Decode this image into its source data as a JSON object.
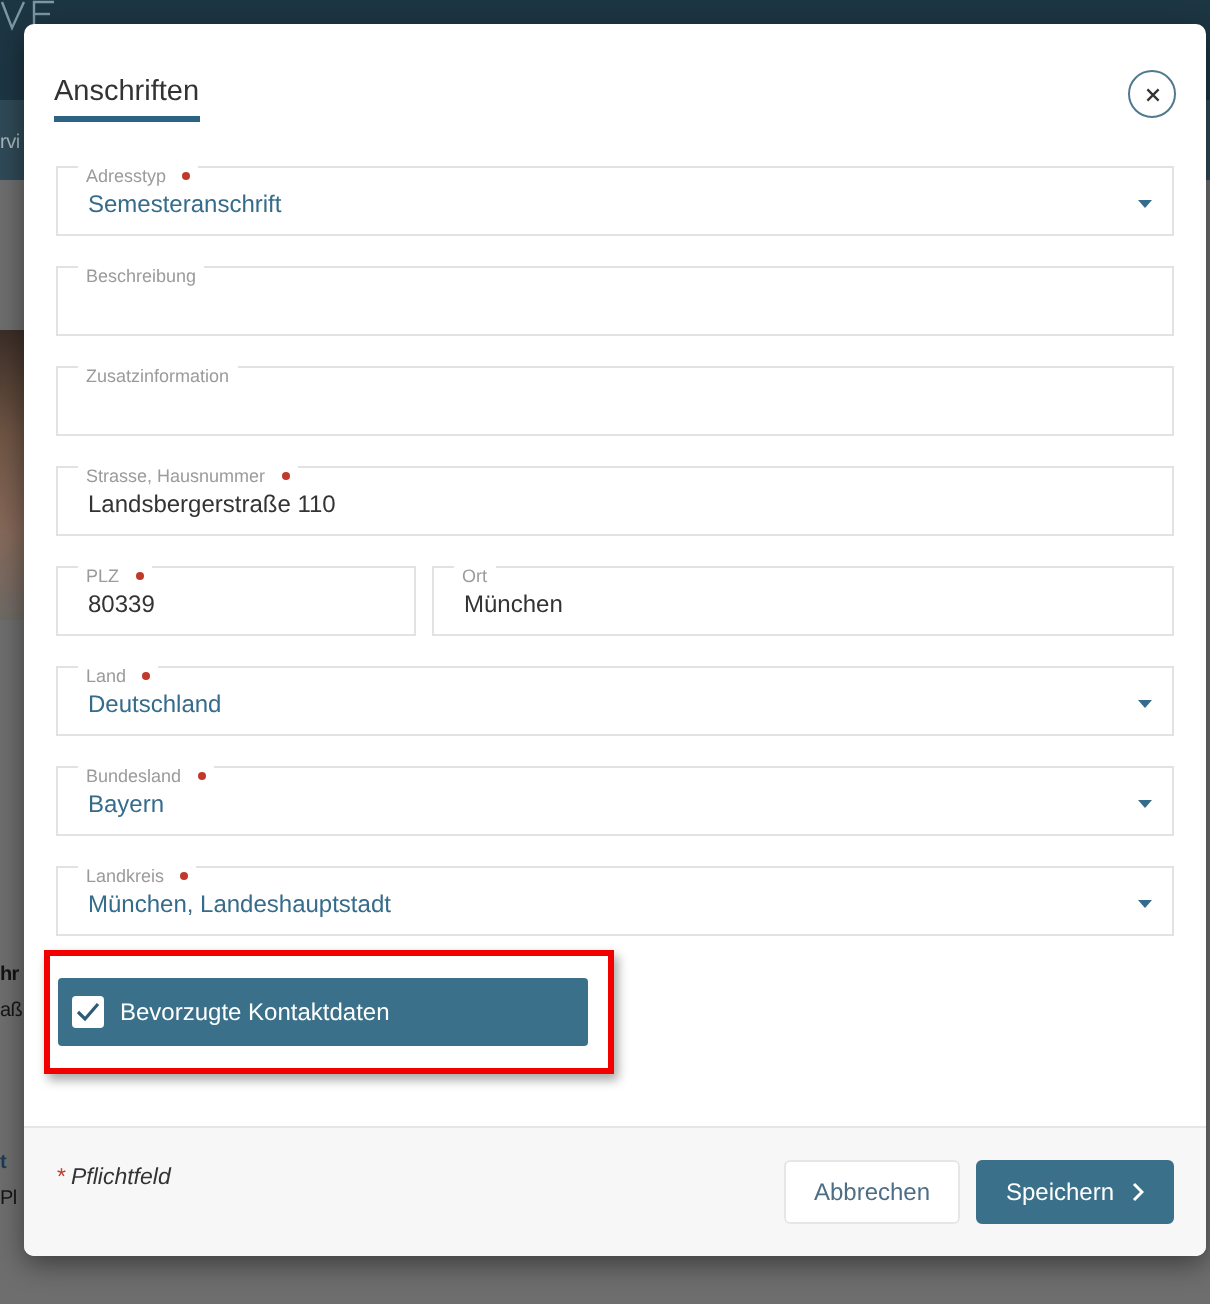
{
  "page_behind": {
    "nav_item": "rvi",
    "text_groups": [
      {
        "kind": "plain",
        "title": "hr",
        "detail": "aß"
      },
      {
        "kind": "link",
        "title": "t",
        "detail": "Pl"
      }
    ]
  },
  "dialog": {
    "title": "Anschriften",
    "fields": [
      {
        "kind": "select",
        "label": "Adresstyp",
        "required": true,
        "value": "Semesteranschrift"
      },
      {
        "kind": "input",
        "label": "Beschreibung",
        "required": false
      },
      {
        "kind": "input",
        "label": "Zusatzinformation",
        "required": false
      },
      {
        "kind": "input",
        "label": "Strasse, Hausnummer",
        "required": true,
        "value": "Landsbergerstraße 110"
      },
      {
        "kind": "pair",
        "fields": [
          {
            "kind": "input",
            "label": "PLZ",
            "required": true,
            "value": "80339"
          },
          {
            "kind": "input",
            "label": "Ort",
            "required": false,
            "value": "München"
          }
        ]
      },
      {
        "kind": "select",
        "label": "Land",
        "required": true,
        "value": "Deutschland"
      },
      {
        "kind": "select",
        "label": "Bundesland",
        "required": true,
        "value": "Bayern"
      },
      {
        "kind": "select",
        "label": "Landkreis",
        "required": true,
        "value": "München, Landeshauptstadt"
      }
    ],
    "preferred_contact": {
      "label": "Bevorzugte Kontaktdaten",
      "checked": true,
      "highlighted": true
    },
    "required_note": {
      "mark": "*",
      "text": "Pflichtfeld"
    },
    "buttons": [
      {
        "kind": "secondary",
        "label": "Abbrechen"
      },
      {
        "kind": "primary",
        "label": "Speichern"
      }
    ]
  }
}
